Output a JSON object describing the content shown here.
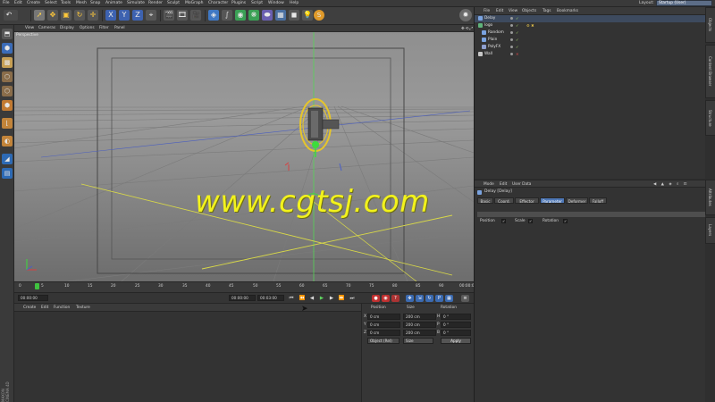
{
  "menubar": {
    "items": [
      "File",
      "Edit",
      "Create",
      "Select",
      "Tools",
      "Mesh",
      "Snap",
      "Animate",
      "Simulate",
      "Render",
      "Sculpt",
      "MoGraph",
      "Character",
      "Plugins",
      "Script",
      "Window",
      "Help"
    ],
    "layout_label": "Layout:",
    "layout_value": "Startup (User)"
  },
  "toolbar": {
    "icons": [
      "undo-icon",
      "move-select-icon",
      "move-icon",
      "scale-icon",
      "rotate-icon",
      "add-icon",
      "x-axis-icon",
      "y-axis-icon",
      "z-axis-icon",
      "world-coords-icon",
      "render-region-icon",
      "render-view-icon",
      "render-settings-icon",
      "cube-icon",
      "spline-pen-icon",
      "subdivision-icon",
      "array-icon",
      "deformer-icon",
      "floor-icon",
      "camera-icon",
      "light-icon",
      "python-icon"
    ]
  },
  "left_toolbar": {
    "icons": [
      "make-editable-icon",
      "model-mode-icon",
      "texture-mode-icon",
      "points-mode-icon",
      "edges-mode-icon",
      "polygons-mode-icon",
      "axis-mode-icon",
      "tweak-icon",
      "snap-icon",
      "workplane-icon"
    ]
  },
  "viewport": {
    "menu": [
      "View",
      "Cameras",
      "Display",
      "Options",
      "Filter",
      "Panel"
    ],
    "label": "Perspective",
    "accent": "#f2f21c"
  },
  "watermark": "www.cgtsj.com",
  "timeline": {
    "ticks": [
      "0",
      "5",
      "10",
      "15",
      "20",
      "25",
      "30",
      "35",
      "40",
      "45",
      "50",
      "55",
      "60",
      "65",
      "70",
      "75",
      "80",
      "85",
      "90"
    ],
    "current_frame": 3,
    "readout": "00:00:06"
  },
  "transport": {
    "start": "00:00:00",
    "mid": "00:00:00",
    "end": "00:03:00"
  },
  "material_manager": {
    "menu": [
      "Create",
      "Edit",
      "Function",
      "Texture"
    ]
  },
  "coordinates": {
    "headers": [
      "Position",
      "Size",
      "Rotation"
    ],
    "rows": [
      {
        "axis": "X",
        "pos": "0 cm",
        "size": "200 cm",
        "rlabel": "H",
        "rot": "0 °"
      },
      {
        "axis": "Y",
        "pos": "0 cm",
        "size": "200 cm",
        "rlabel": "P",
        "rot": "0 °"
      },
      {
        "axis": "Z",
        "pos": "0 cm",
        "size": "200 cm",
        "rlabel": "B",
        "rot": "0 °"
      }
    ],
    "mode": "Object (Rel)",
    "size_mode": "Size",
    "apply": "Apply"
  },
  "object_manager": {
    "menu": [
      "File",
      "Edit",
      "View",
      "Objects",
      "Tags",
      "Bookmarks"
    ],
    "objects": [
      {
        "name": "Delay",
        "indent": 0,
        "selected": true,
        "color": "#9ab9e8"
      },
      {
        "name": "logo",
        "indent": 0,
        "selected": false,
        "color": "#8fc3a0"
      },
      {
        "name": "Random",
        "indent": 1,
        "selected": false,
        "color": "#c7c7c7"
      },
      {
        "name": "Plain",
        "indent": 1,
        "selected": false,
        "color": "#c7c7c7"
      },
      {
        "name": "PolyFX",
        "indent": 1,
        "selected": false,
        "color": "#c7c7c7"
      },
      {
        "name": "Wall",
        "indent": 0,
        "selected": false,
        "color": "#c7c7c7"
      }
    ]
  },
  "attribute_manager": {
    "menu": [
      "Mode",
      "Edit",
      "User Data"
    ],
    "title": "Delay [Delay]",
    "tabs": [
      "Basic",
      "Coord.",
      "Effector",
      "Parameter",
      "Deformer",
      "Falloff"
    ],
    "active_tab": "Parameter",
    "params": [
      {
        "label": "Position",
        "checked": true
      },
      {
        "label": "Scale",
        "checked": true
      },
      {
        "label": "Rotation",
        "checked": true
      }
    ]
  },
  "side_tabs": [
    "Objects",
    "Content Browser",
    "Structure",
    "Attributes",
    "Layers"
  ]
}
